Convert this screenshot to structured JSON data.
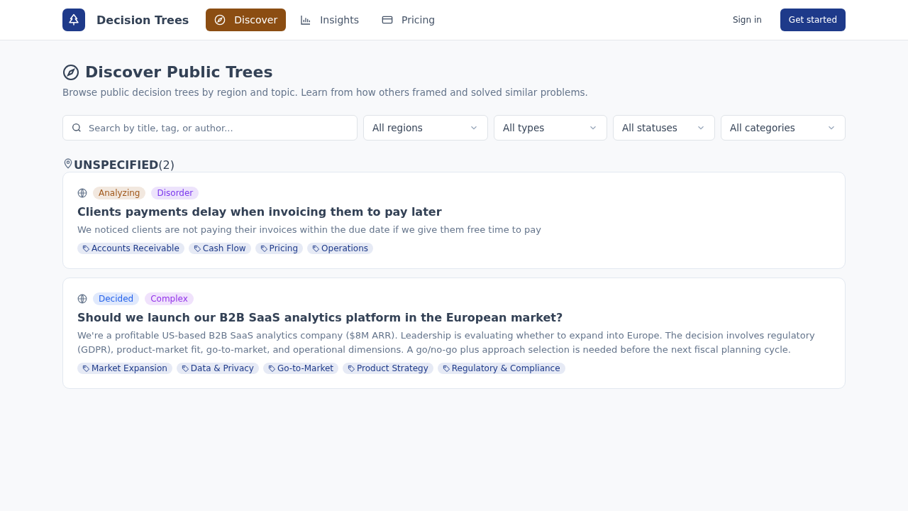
{
  "header": {
    "brand": "Decision Trees",
    "nav": [
      {
        "label": "Discover",
        "selected": true
      },
      {
        "label": "Insights",
        "selected": false
      },
      {
        "label": "Pricing",
        "selected": false
      }
    ],
    "sign_in": "Sign in",
    "cta": "Get started"
  },
  "page": {
    "title": "Discover Public Trees",
    "subtitle": "Browse public decision trees by region and topic. Learn from how others framed and solved similar problems."
  },
  "filters": {
    "search": {
      "placeholder": "Search by title, tag, or author..."
    },
    "selects": [
      "All regions",
      "All types",
      "All statuses",
      "All categories"
    ]
  },
  "group": {
    "name": "UNSPECIFIED",
    "count": "(2)"
  },
  "cards": [
    {
      "badges": [
        {
          "label": "Analyzing",
          "color": "#a0581b"
        },
        {
          "label": "Disorder",
          "color": "#7c3aed"
        }
      ],
      "title": "Clients payments delay when invoicing them to pay later",
      "description": "We noticed clients are not paying their invoices within the due date if we give them free time to pay",
      "tags": [
        "Accounts Receivable",
        "Cash Flow",
        "Pricing",
        "Operations"
      ]
    },
    {
      "badges": [
        {
          "label": "Decided",
          "color": "#2563eb"
        },
        {
          "label": "Complex",
          "color": "#9333ea"
        }
      ],
      "title": "Should we launch our B2B SaaS analytics platform in the European market?",
      "description": "We're a profitable US-based B2B SaaS analytics company ($8M ARR). Leadership is evaluating whether to expand into Europe. The decision involves regulatory (GDPR), product-market fit, go-to-market, and operational dimensions. A go/no-go plus approach selection is needed before the next fiscal planning cycle.",
      "tags": [
        "Market Expansion",
        "Data & Privacy",
        "Go-to-Market",
        "Product Strategy",
        "Regulatory & Compliance"
      ]
    }
  ]
}
